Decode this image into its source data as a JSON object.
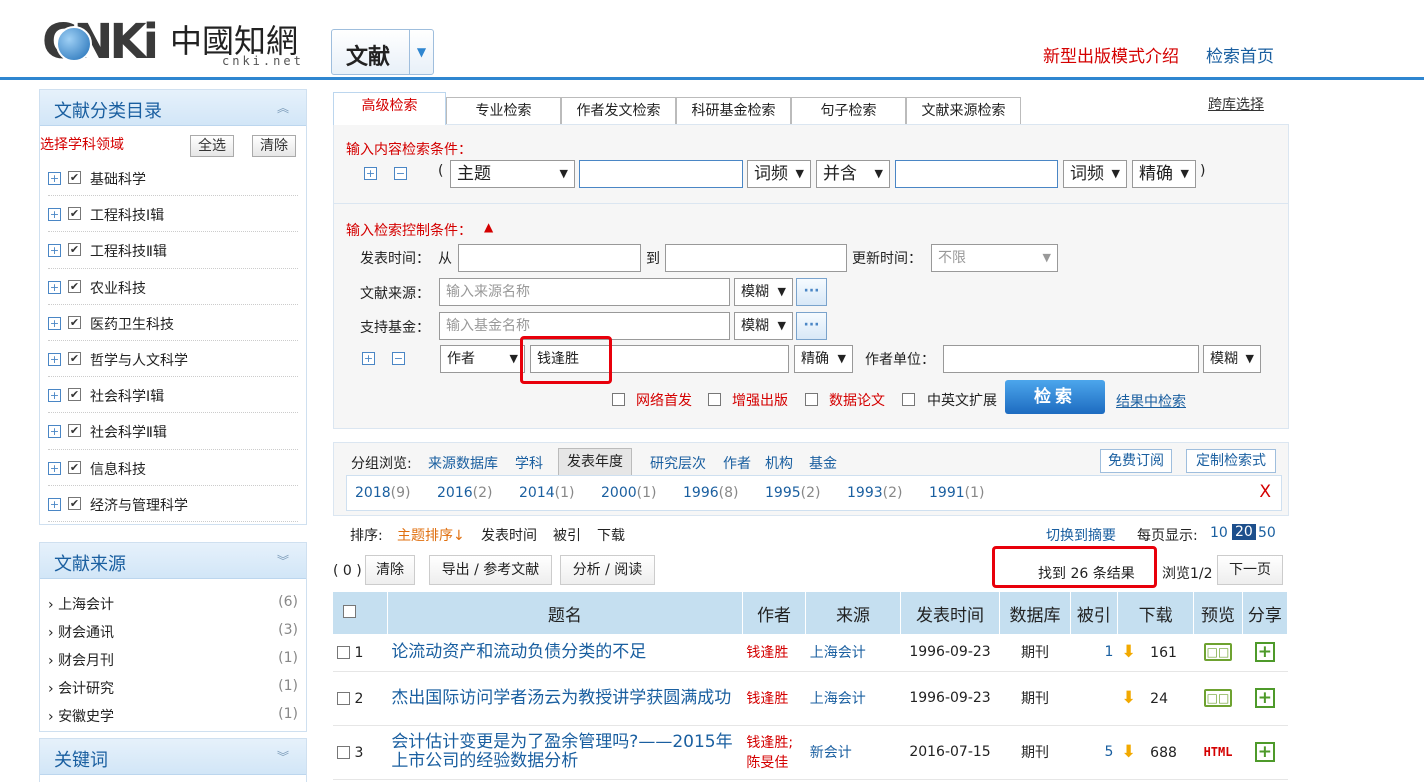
{
  "header": {
    "logo_cnki": "CNKi",
    "logo_cn": "中國知網",
    "logo_net": "cnki.net",
    "doc_type": "文献",
    "link_new_mode": "新型出版模式介绍",
    "link_home": "检索首页"
  },
  "sidebar": {
    "category_title": "文献分类目录",
    "choose_field": "选择学科领域",
    "select_all": "全选",
    "clear": "清除",
    "subjects": [
      "基础科学",
      "工程科技Ⅰ辑",
      "工程科技Ⅱ辑",
      "农业科技",
      "医药卫生科技",
      "哲学与人文科学",
      "社会科学Ⅰ辑",
      "社会科学Ⅱ辑",
      "信息科技",
      "经济与管理科学"
    ],
    "source_title": "文献来源",
    "sources": [
      {
        "name": "上海会计",
        "count": "(6)"
      },
      {
        "name": "财会通讯",
        "count": "(3)"
      },
      {
        "name": "财会月刊",
        "count": "(1)"
      },
      {
        "name": "会计研究",
        "count": "(1)"
      },
      {
        "name": "安徽史学",
        "count": "(1)"
      }
    ],
    "keyword_title": "关键词"
  },
  "tabs": [
    "高级检索",
    "专业检索",
    "作者发文检索",
    "科研基金检索",
    "句子检索",
    "文献来源检索"
  ],
  "cross_lib": "跨库选择",
  "search": {
    "content_label": "输入内容检索条件：",
    "paren_open": "(",
    "paren_close": ")",
    "field1": "主题",
    "freq1": "词频",
    "logic": "并含",
    "freq2": "词频",
    "match": "精确",
    "control_label": "输入检索控制条件：",
    "pub_time": "发表时间：",
    "from": "从",
    "to": "到",
    "update_time": "更新时间：",
    "update_val": "不限",
    "source_label": "文献来源：",
    "source_ph": "输入来源名称",
    "fuzzy": "模糊",
    "fund_label": "支持基金：",
    "fund_ph": "输入基金名称",
    "author_field": "作者",
    "author_value": "钱逢胜",
    "author_match": "精确",
    "org_label": "作者单位：",
    "org_match": "模糊",
    "opt1": "网络首发",
    "opt2": "增强出版",
    "opt3": "数据论文",
    "opt4": "中英文扩展",
    "search_btn": "检索",
    "result_search": "结果中检索",
    "more": "···"
  },
  "group": {
    "label": "分组浏览:",
    "items": [
      "来源数据库",
      "学科",
      "发表年度",
      "研究层次",
      "作者",
      "机构",
      "基金"
    ],
    "free_sub": "免费订阅",
    "custom": "定制检索式",
    "years": [
      {
        "y": "2018",
        "c": "(9)"
      },
      {
        "y": "2016",
        "c": "(2)"
      },
      {
        "y": "2014",
        "c": "(1)"
      },
      {
        "y": "2000",
        "c": "(1)"
      },
      {
        "y": "1996",
        "c": "(8)"
      },
      {
        "y": "1995",
        "c": "(2)"
      },
      {
        "y": "1993",
        "c": "(2)"
      },
      {
        "y": "1991",
        "c": "(1)"
      }
    ],
    "close": "X"
  },
  "sort": {
    "label": "排序:",
    "items": [
      "主题排序↓",
      "发表时间",
      "被引",
      "下载"
    ],
    "switch": "切换到摘要",
    "per_page": "每页显示:",
    "pages": [
      "10",
      "20",
      "50"
    ],
    "count": "( 0 )",
    "clear": "清除",
    "export": "导出 / 参考文献",
    "analyze": "分析 / 阅读",
    "found": "找到 26 条结果",
    "browse": "浏览1/2",
    "next": "下一页"
  },
  "table": {
    "headers": [
      "题名",
      "作者",
      "来源",
      "发表时间",
      "数据库",
      "被引",
      "下载",
      "预览",
      "分享"
    ],
    "rows": [
      {
        "n": "1",
        "title": "论流动资产和流动负债分类的不足",
        "author": "钱逢胜",
        "source": "上海会计",
        "date": "1996-09-23",
        "db": "期刊",
        "cite": "1",
        "dl": "161"
      },
      {
        "n": "2",
        "title": "杰出国际访问学者汤云为教授讲学获圆满成功",
        "author": "钱逢胜",
        "source": "上海会计",
        "date": "1996-09-23",
        "db": "期刊",
        "cite": "",
        "dl": "24"
      },
      {
        "n": "3",
        "title": "会计估计变更是为了盈余管理吗?——2015年上市公司的经验数据分析",
        "author": "钱逢胜;陈旻佳",
        "source": "新会计",
        "date": "2016-07-15",
        "db": "期刊",
        "cite": "5",
        "dl": "688"
      }
    ],
    "html_label": "HTML",
    "preview_glyph": "□□",
    "share_glyph": "+",
    "download_glyph": "⬇"
  }
}
